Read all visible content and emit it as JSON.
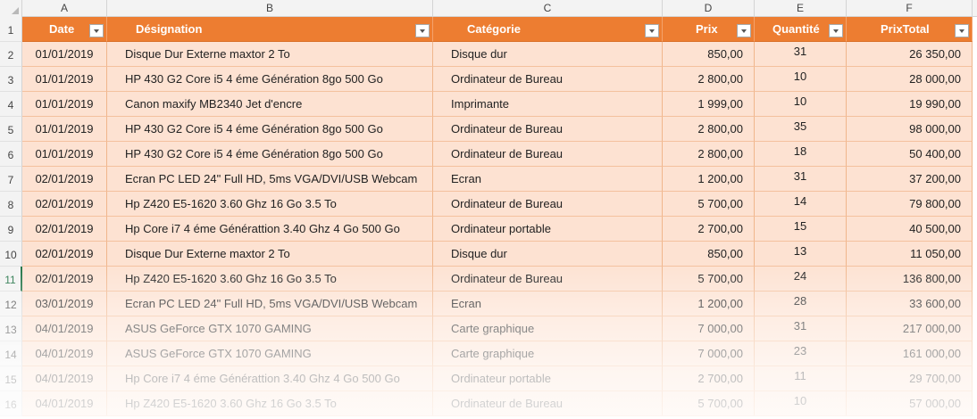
{
  "columns": [
    "A",
    "B",
    "C",
    "D",
    "E",
    "F"
  ],
  "row_numbers": [
    "1",
    "2",
    "3",
    "4",
    "5",
    "6",
    "7",
    "8",
    "9",
    "10",
    "11",
    "12",
    "13",
    "14",
    "15",
    "16"
  ],
  "active_row": "11",
  "headers": {
    "date": "Date",
    "designation": "Désignation",
    "categorie": "Catégorie",
    "prix": "Prix",
    "quantite": "Quantité",
    "prixtotal": "PrixTotal"
  },
  "rows": [
    {
      "date": "01/01/2019",
      "designation": "Disque Dur Externe maxtor 2 To",
      "categorie": "Disque dur",
      "prix": "850,00",
      "quantite": "31",
      "total": "26 350,00"
    },
    {
      "date": "01/01/2019",
      "designation": "HP 430 G2 Core i5 4 éme Génération 8go 500 Go",
      "categorie": "Ordinateur de Bureau",
      "prix": "2 800,00",
      "quantite": "10",
      "total": "28 000,00"
    },
    {
      "date": "01/01/2019",
      "designation": "Canon maxify MB2340 Jet d'encre",
      "categorie": "Imprimante",
      "prix": "1 999,00",
      "quantite": "10",
      "total": "19 990,00"
    },
    {
      "date": "01/01/2019",
      "designation": "HP 430 G2 Core i5 4 éme Génération 8go 500 Go",
      "categorie": "Ordinateur de Bureau",
      "prix": "2 800,00",
      "quantite": "35",
      "total": "98 000,00"
    },
    {
      "date": "01/01/2019",
      "designation": "HP 430 G2 Core i5 4 éme Génération 8go 500 Go",
      "categorie": "Ordinateur de Bureau",
      "prix": "2 800,00",
      "quantite": "18",
      "total": "50 400,00"
    },
    {
      "date": "02/01/2019",
      "designation": "Ecran PC LED 24\" Full HD, 5ms VGA/DVI/USB Webcam",
      "categorie": "Ecran",
      "prix": "1 200,00",
      "quantite": "31",
      "total": "37 200,00"
    },
    {
      "date": "02/01/2019",
      "designation": "Hp Z420 E5-1620 3.60 Ghz 16 Go 3.5 To",
      "categorie": "Ordinateur de Bureau",
      "prix": "5 700,00",
      "quantite": "14",
      "total": "79 800,00"
    },
    {
      "date": "02/01/2019",
      "designation": "Hp Core i7 4 éme Générattion 3.40 Ghz 4 Go 500 Go",
      "categorie": "Ordinateur portable",
      "prix": "2 700,00",
      "quantite": "15",
      "total": "40 500,00"
    },
    {
      "date": "02/01/2019",
      "designation": "Disque Dur Externe maxtor 2 To",
      "categorie": "Disque dur",
      "prix": "850,00",
      "quantite": "13",
      "total": "11 050,00"
    },
    {
      "date": "02/01/2019",
      "designation": "Hp Z420 E5-1620 3.60 Ghz 16 Go 3.5 To",
      "categorie": "Ordinateur de Bureau",
      "prix": "5 700,00",
      "quantite": "24",
      "total": "136 800,00"
    },
    {
      "date": "03/01/2019",
      "designation": "Ecran PC LED 24\" Full HD, 5ms VGA/DVI/USB Webcam",
      "categorie": "Ecran",
      "prix": "1 200,00",
      "quantite": "28",
      "total": "33 600,00"
    },
    {
      "date": "04/01/2019",
      "designation": "ASUS GeForce GTX 1070 GAMING",
      "categorie": "Carte graphique",
      "prix": "7 000,00",
      "quantite": "31",
      "total": "217 000,00"
    },
    {
      "date": "04/01/2019",
      "designation": "ASUS GeForce GTX 1070 GAMING",
      "categorie": "Carte graphique",
      "prix": "7 000,00",
      "quantite": "23",
      "total": "161 000,00"
    },
    {
      "date": "04/01/2019",
      "designation": "Hp Core i7 4 éme Générattion 3.40 Ghz 4 Go 500 Go",
      "categorie": "Ordinateur portable",
      "prix": "2 700,00",
      "quantite": "11",
      "total": "29 700,00"
    },
    {
      "date": "04/01/2019",
      "designation": "Hp Z420 E5-1620 3.60 Ghz 16 Go 3.5 To",
      "categorie": "Ordinateur de Bureau",
      "prix": "5 700,00",
      "quantite": "10",
      "total": "57 000,00"
    }
  ],
  "colors": {
    "header_fill": "#ed7d31",
    "row_fill": "#fde2d2",
    "grid_line": "#f4c19e",
    "active_row_accent": "#217346"
  },
  "icons": {
    "filter": "filter-dropdown-icon",
    "select_all": "select-all-triangle-icon"
  }
}
